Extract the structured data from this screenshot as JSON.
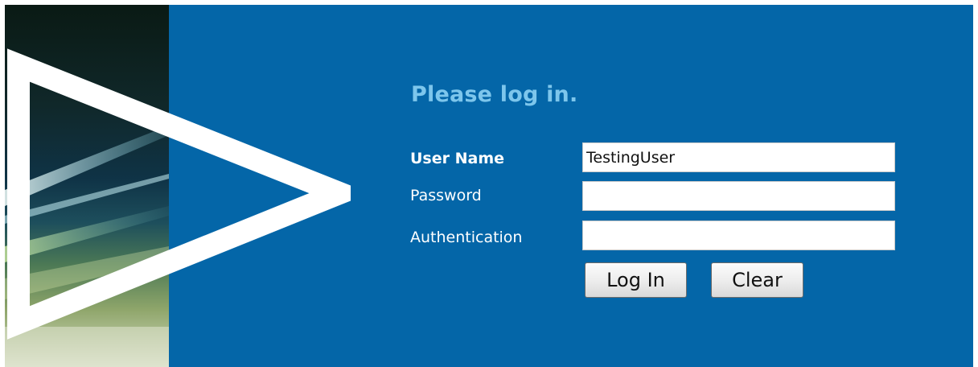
{
  "login": {
    "title": "Please log in.",
    "username": {
      "label": "User Name",
      "value": "TestingUser"
    },
    "password": {
      "label": "Password",
      "value": ""
    },
    "authentication": {
      "label": "Authentication",
      "value": ""
    },
    "buttons": {
      "login": "Log In",
      "clear": "Clear"
    }
  },
  "colors": {
    "background": "#0466a8",
    "title": "#7dc6ec",
    "label": "#ffffff",
    "triangle": "#ffffff"
  },
  "icons": {
    "brand_mark": "play-triangle-logo"
  }
}
